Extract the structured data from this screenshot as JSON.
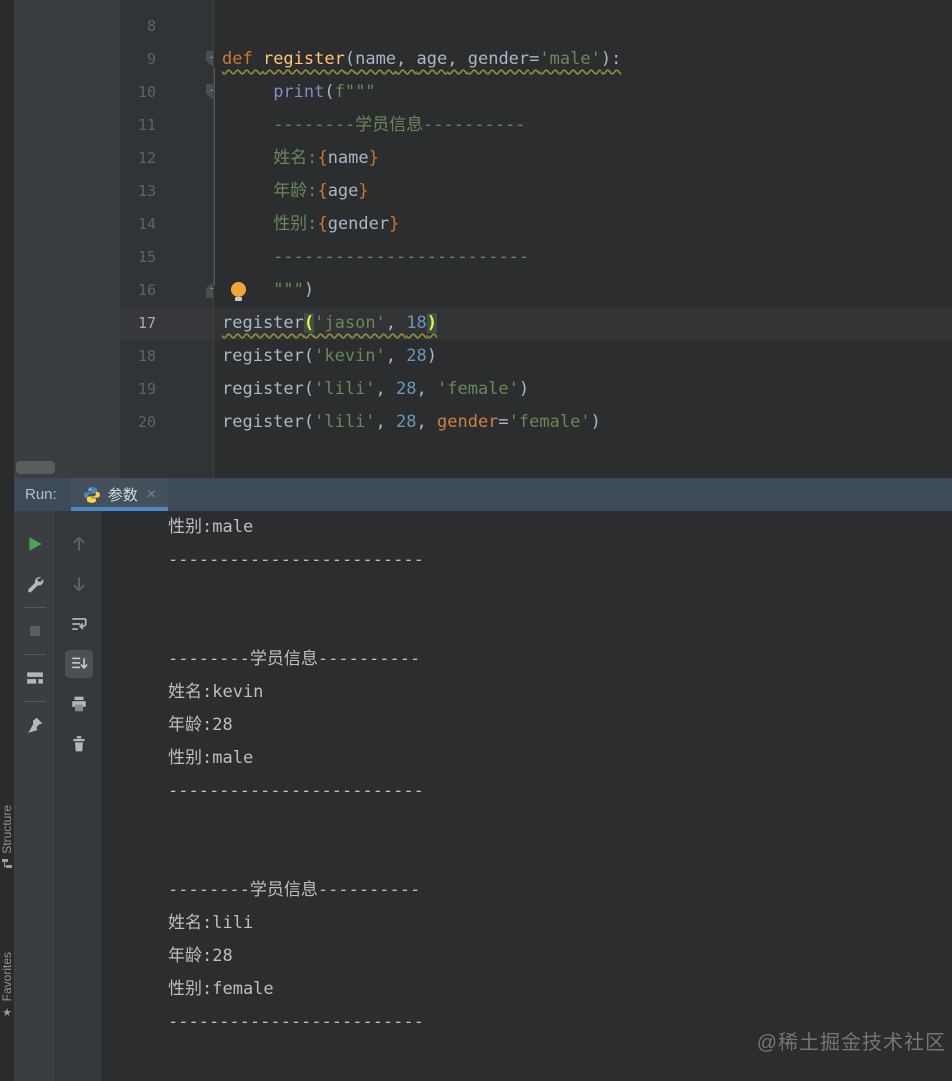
{
  "watermark": "@稀土掘金技术社区",
  "colors": {
    "accent_blue": "#4a88c7",
    "run_green": "#4f9e58",
    "bulb_yellow": "#f2a63a",
    "editor_bg": "#2b2d2e",
    "header_bg": "#3d4a57"
  },
  "left_bar": {
    "structure_label": "Structure",
    "favorites_label": "Favorites"
  },
  "editor": {
    "lines": [
      {
        "n": "8",
        "tokens": []
      },
      {
        "n": "9",
        "wavy": true,
        "fold": "down",
        "tokens": [
          [
            "kw",
            "def "
          ],
          [
            "fn",
            "register"
          ],
          [
            "d",
            "("
          ],
          [
            "d",
            "name"
          ],
          [
            "d",
            ", "
          ],
          [
            "d",
            "age"
          ],
          [
            "d",
            ", "
          ],
          [
            "d",
            "gender"
          ],
          [
            "d",
            "="
          ],
          [
            "s",
            "'male'"
          ],
          [
            "d",
            "):"
          ]
        ]
      },
      {
        "n": "10",
        "fold": "down",
        "tokens": [
          [
            "d",
            "     "
          ],
          [
            "bi",
            "print"
          ],
          [
            "d",
            "("
          ],
          [
            "s",
            "f\"\"\""
          ]
        ]
      },
      {
        "n": "11",
        "tokens": [
          [
            "d",
            "     "
          ],
          [
            "s",
            "--------学员信息----------"
          ]
        ]
      },
      {
        "n": "12",
        "tokens": [
          [
            "d",
            "     "
          ],
          [
            "s",
            "姓名:"
          ],
          [
            "br",
            "{"
          ],
          [
            "d",
            "name"
          ],
          [
            "br",
            "}"
          ]
        ]
      },
      {
        "n": "13",
        "tokens": [
          [
            "d",
            "     "
          ],
          [
            "s",
            "年龄:"
          ],
          [
            "br",
            "{"
          ],
          [
            "d",
            "age"
          ],
          [
            "br",
            "}"
          ]
        ]
      },
      {
        "n": "14",
        "tokens": [
          [
            "d",
            "     "
          ],
          [
            "s",
            "性别:"
          ],
          [
            "br",
            "{"
          ],
          [
            "d",
            "gender"
          ],
          [
            "br",
            "}"
          ]
        ]
      },
      {
        "n": "15",
        "tokens": [
          [
            "d",
            "     "
          ],
          [
            "s",
            "-------------------------"
          ]
        ]
      },
      {
        "n": "16",
        "fold": "up",
        "bulb": true,
        "tokens": [
          [
            "d",
            "     "
          ],
          [
            "s",
            "\"\"\""
          ],
          [
            "d",
            ")"
          ]
        ]
      },
      {
        "n": "17",
        "current": true,
        "wavy": true,
        "tokens": [
          [
            "d",
            "register"
          ],
          [
            "hp",
            "("
          ],
          [
            "s",
            "'jason'"
          ],
          [
            "d",
            ", "
          ],
          [
            "n2",
            "18"
          ],
          [
            "hp",
            ")"
          ]
        ]
      },
      {
        "n": "18",
        "tokens": [
          [
            "d",
            "register("
          ],
          [
            "s",
            "'kevin'"
          ],
          [
            "d",
            ", "
          ],
          [
            "n2",
            "28"
          ],
          [
            "d",
            ")"
          ]
        ]
      },
      {
        "n": "19",
        "tokens": [
          [
            "d",
            "register("
          ],
          [
            "s",
            "'lili'"
          ],
          [
            "d",
            ", "
          ],
          [
            "n2",
            "28"
          ],
          [
            "d",
            ", "
          ],
          [
            "s",
            "'female'"
          ],
          [
            "d",
            ")"
          ]
        ]
      },
      {
        "n": "20",
        "tokens": [
          [
            "d",
            "register("
          ],
          [
            "s",
            "'lili'"
          ],
          [
            "d",
            ", "
          ],
          [
            "n2",
            "28"
          ],
          [
            "d",
            ", "
          ],
          [
            "kwarg",
            "gender"
          ],
          [
            "d",
            "="
          ],
          [
            "s",
            "'female'"
          ],
          [
            "d",
            ")"
          ]
        ]
      }
    ]
  },
  "run": {
    "label": "Run:",
    "tab_label": "参数",
    "close_label": "×",
    "toolbar_left_icons": [
      "rerun-icon",
      "settings-wrench-icon",
      "stop-icon",
      "restore-layout-icon",
      "pin-icon"
    ],
    "toolbar_right_icons": [
      "up-arrow-icon",
      "down-arrow-icon",
      "soft-wrap-icon",
      "scroll-to-end-icon",
      "print-icon",
      "clear-trash-icon"
    ],
    "console_lines": [
      "性别:male",
      "-------------------------",
      "",
      "",
      "--------学员信息----------",
      "姓名:kevin",
      "年龄:28",
      "性别:male",
      "-------------------------",
      "",
      "",
      "--------学员信息----------",
      "姓名:lili",
      "年龄:28",
      "性别:female",
      "-------------------------"
    ]
  }
}
